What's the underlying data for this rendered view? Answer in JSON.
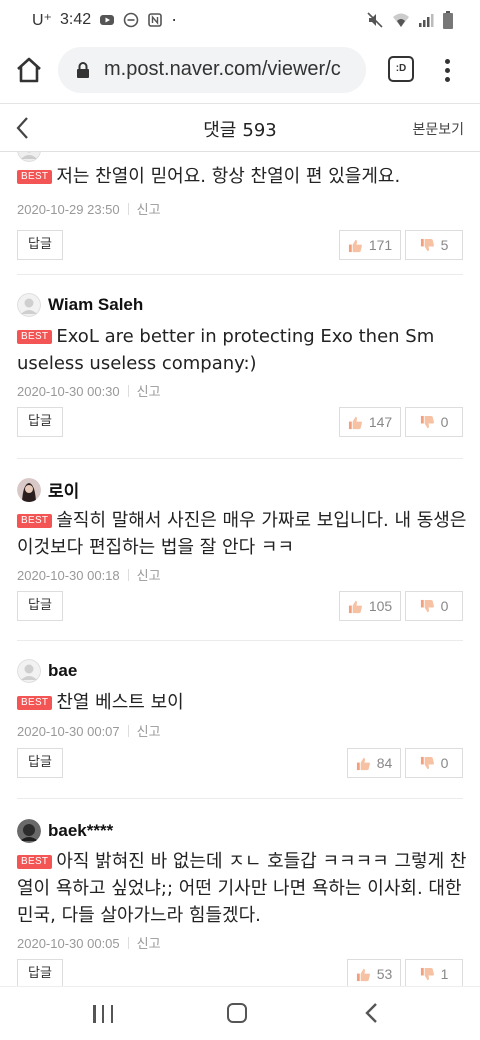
{
  "status_bar": {
    "carrier": "U⁺",
    "time": "3:42",
    "dot": "·"
  },
  "browser": {
    "url": "m.post.naver.com/viewer/c",
    "tab_label": ":D"
  },
  "header": {
    "title": "댓글",
    "count": "593",
    "original_link": "본문보기"
  },
  "best_label": "BEST",
  "reply_label": "답글",
  "report_label": "신고",
  "comments": [
    {
      "author": "",
      "text": "저는 찬열이 믿어요. 항상 찬열이 편 있을게요.",
      "date": "2020-10-29 23:50",
      "likes": "171",
      "dislikes": "5"
    },
    {
      "author": "Wiam Saleh",
      "text": "ExoL are better in protecting Exo then Sm useless useless company:)",
      "date": "2020-10-30 00:30",
      "likes": "147",
      "dislikes": "0"
    },
    {
      "author": "로이",
      "text": "솔직히 말해서 사진은 매우 가짜로 보입니다. 내 동생은 이것보다 편집하는 법을 잘 안다 ㅋㅋ",
      "date": "2020-10-30 00:18",
      "likes": "105",
      "dislikes": "0"
    },
    {
      "author": "bae",
      "text": "찬열 베스트 보이",
      "date": "2020-10-30 00:07",
      "likes": "84",
      "dislikes": "0"
    },
    {
      "author": "baek****",
      "text": "아직 밝혀진 바 없는데 ㅈㄴ 호들갑 ㅋㅋㅋㅋ 그렇게 찬열이 욕하고 싶었냐;; 어떤 기사만 나면 욕하는 이사회. 대한민국, 다들 살아가느라 힘들겠다.",
      "date": "2020-10-30 00:05",
      "likes": "53",
      "dislikes": "1"
    }
  ],
  "colors": {
    "best_badge": "#f35454",
    "like_icon": "#f2a07b",
    "dislike_icon": "#f2a07b"
  }
}
